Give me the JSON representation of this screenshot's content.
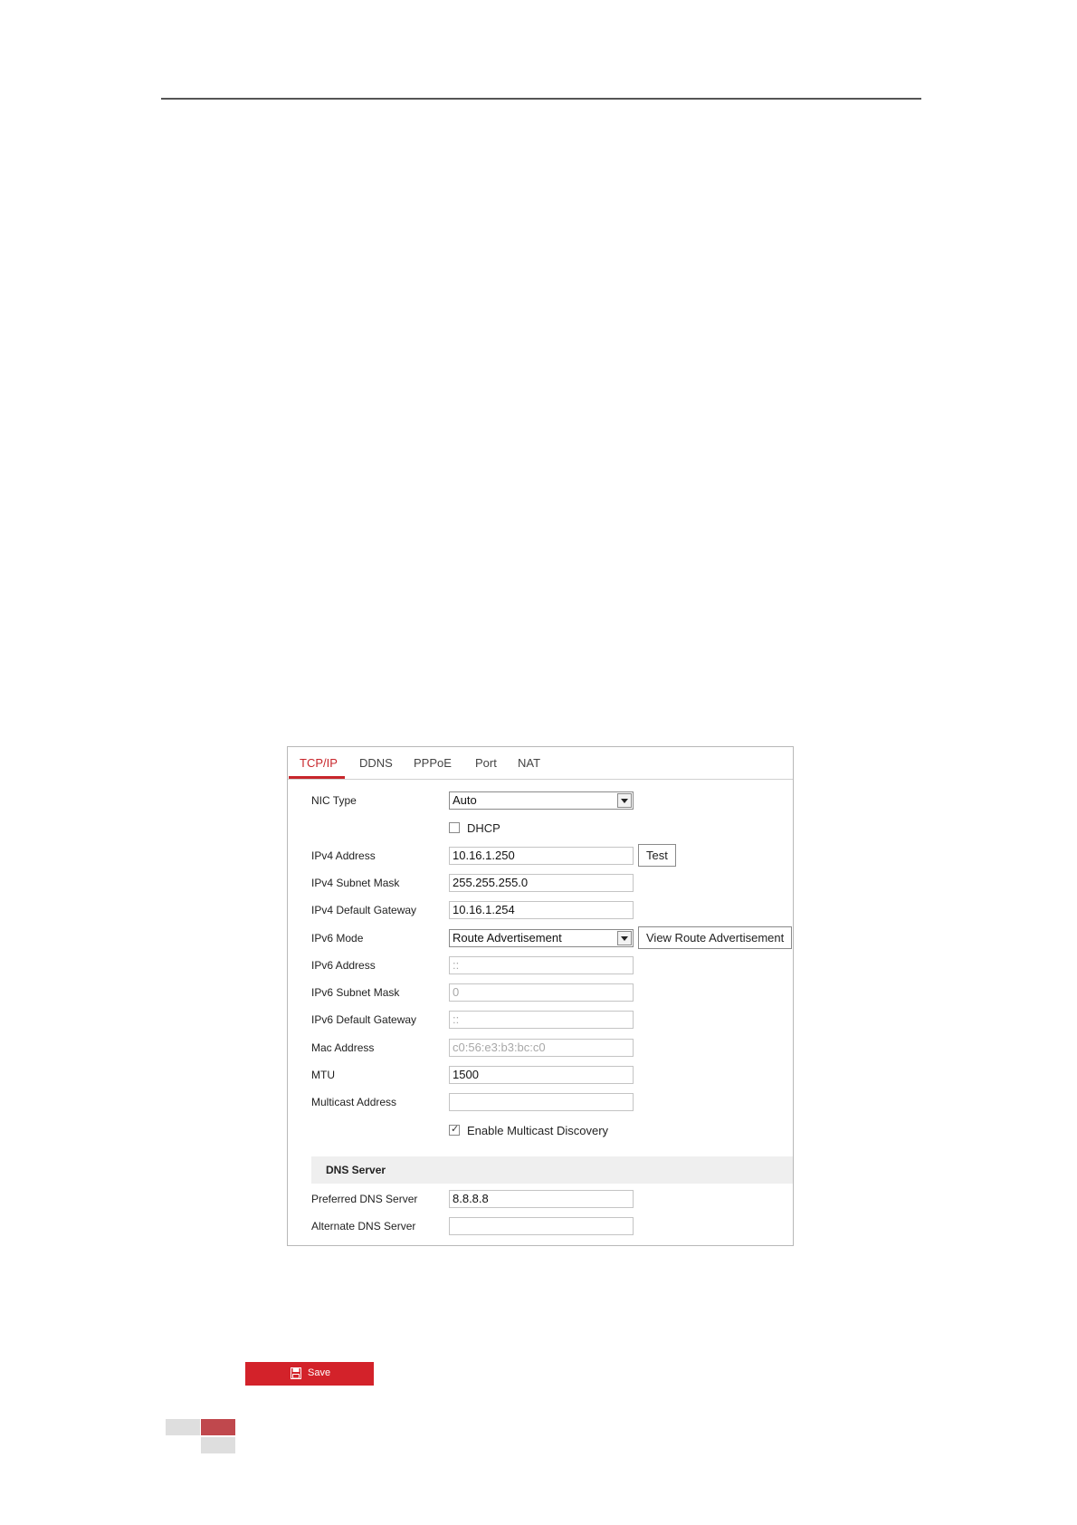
{
  "tabs": [
    {
      "label": "TCP/IP",
      "active": true
    },
    {
      "label": "DDNS"
    },
    {
      "label": "PPPoE"
    },
    {
      "label": "Port"
    },
    {
      "label": "NAT"
    }
  ],
  "form": {
    "nic_type": {
      "label": "NIC Type",
      "value": "Auto"
    },
    "dhcp": {
      "label": "DHCP",
      "checked": false
    },
    "ipv4_address": {
      "label": "IPv4 Address",
      "value": "10.16.1.250",
      "button": "Test"
    },
    "ipv4_subnet_mask": {
      "label": "IPv4 Subnet Mask",
      "value": "255.255.255.0"
    },
    "ipv4_default_gateway": {
      "label": "IPv4 Default Gateway",
      "value": "10.16.1.254"
    },
    "ipv6_mode": {
      "label": "IPv6 Mode",
      "value": "Route Advertisement",
      "button": "View Route Advertisement"
    },
    "ipv6_address": {
      "label": "IPv6 Address",
      "value": "::"
    },
    "ipv6_subnet_mask": {
      "label": "IPv6 Subnet Mask",
      "value": "0"
    },
    "ipv6_default_gateway": {
      "label": "IPv6 Default Gateway",
      "value": "::"
    },
    "mac_address": {
      "label": "Mac Address",
      "value": "c0:56:e3:b3:bc:c0"
    },
    "mtu": {
      "label": "MTU",
      "value": "1500"
    },
    "multicast_address": {
      "label": "Multicast Address",
      "value": ""
    },
    "multicast_discovery": {
      "label": "Enable Multicast Discovery",
      "checked": true
    }
  },
  "dns": {
    "title": "DNS Server",
    "preferred": {
      "label": "Preferred DNS Server",
      "value": "8.8.8.8"
    },
    "alternate": {
      "label": "Alternate DNS Server",
      "value": ""
    }
  },
  "save": {
    "label": "Save"
  },
  "colors": {
    "accent": "#d3222a",
    "tab_active": "#c8262b",
    "deco_red": "#c0484d",
    "deco_gray": "#dedede"
  }
}
